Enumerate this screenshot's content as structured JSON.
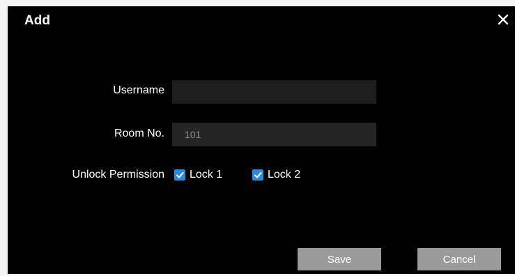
{
  "dialog": {
    "title": "Add",
    "close_icon": "close-icon"
  },
  "form": {
    "username_label": "Username",
    "username_value": "",
    "room_label": "Room No.",
    "room_value": "101",
    "unlock_label": "Unlock Permission",
    "locks": [
      {
        "label": "Lock 1",
        "checked": true
      },
      {
        "label": "Lock 2",
        "checked": true
      }
    ]
  },
  "buttons": {
    "save_label": "Save",
    "cancel_label": "Cancel"
  },
  "colors": {
    "dialog_bg": "#000000",
    "checkbox_accent": "#2e8ad8",
    "button_bg": "#9a9a9a"
  }
}
